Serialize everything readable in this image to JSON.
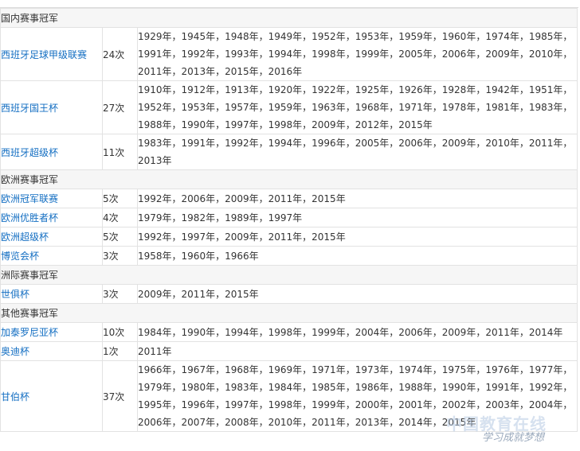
{
  "sections": [
    {
      "title": "国内赛事冠军",
      "rows": [
        {
          "name": "西班牙足球甲级联赛",
          "count": "24次",
          "years": "1929年，1945年，1948年，1949年，1952年，1953年，1959年，1960年，1974年，1985年，1991年，1992年，1993年，1994年，1998年，1999年，2005年，2006年，2009年，2010年，2011年，2013年，2015年，2016年"
        },
        {
          "name": "西班牙国王杯",
          "count": "27次",
          "years": "1910年，1912年，1913年，1920年，1922年，1925年，1926年，1928年，1942年，1951年，1952年，1953年，1957年，1959年，1963年，1968年，1971年，1978年，1981年，1983年，1988年，1990年，1997年，1998年，2009年，2012年，2015年"
        },
        {
          "name": "西班牙超级杯",
          "count": "11次",
          "years": "1983年，1991年，1992年，1994年，1996年，2005年，2006年，2009年，2010年，2011年，2013年"
        }
      ]
    },
    {
      "title": "欧洲赛事冠军",
      "rows": [
        {
          "name": "欧洲冠军联赛",
          "count": "5次",
          "years": "1992年，2006年，2009年，2011年，2015年"
        },
        {
          "name": "欧洲优胜者杯",
          "count": "4次",
          "years": "1979年，1982年，1989年，1997年"
        },
        {
          "name": "欧洲超级杯",
          "count": "5次",
          "years": "1992年，1997年，2009年，2011年，2015年"
        },
        {
          "name": "博览会杯",
          "count": "3次",
          "years": "1958年，1960年，1966年"
        }
      ]
    },
    {
      "title": "洲际赛事冠军",
      "rows": [
        {
          "name": "世俱杯",
          "count": "3次",
          "years": "2009年，2011年，2015年"
        }
      ]
    },
    {
      "title": "其他赛事冠军",
      "rows": [
        {
          "name": "加泰罗尼亚杯",
          "count": "10次",
          "years": "1984年，1990年，1994年，1998年，1999年，2004年，2006年，2009年，2011年，2014年"
        },
        {
          "name": "奥迪杯",
          "count": "1次",
          "years": "2011年"
        },
        {
          "name": "甘伯杯",
          "count": "37次",
          "years": "1966年，1967年，1968年，1969年，1971年，1973年，1974年，1975年，1976年，1977年，1979年，1980年，1983年，1984年，1985年，1986年，1988年，1990年，1991年，1992年，1995年，1996年，1997年，1998年，1999年，2000年，2001年，2002年，2003年，2004年，2006年，2007年，2008年，2010年，2011年，2013年，2014年，2015年"
        }
      ]
    }
  ],
  "watermark": {
    "text": "中国教育在线",
    "slogan": "学习成就梦想"
  }
}
